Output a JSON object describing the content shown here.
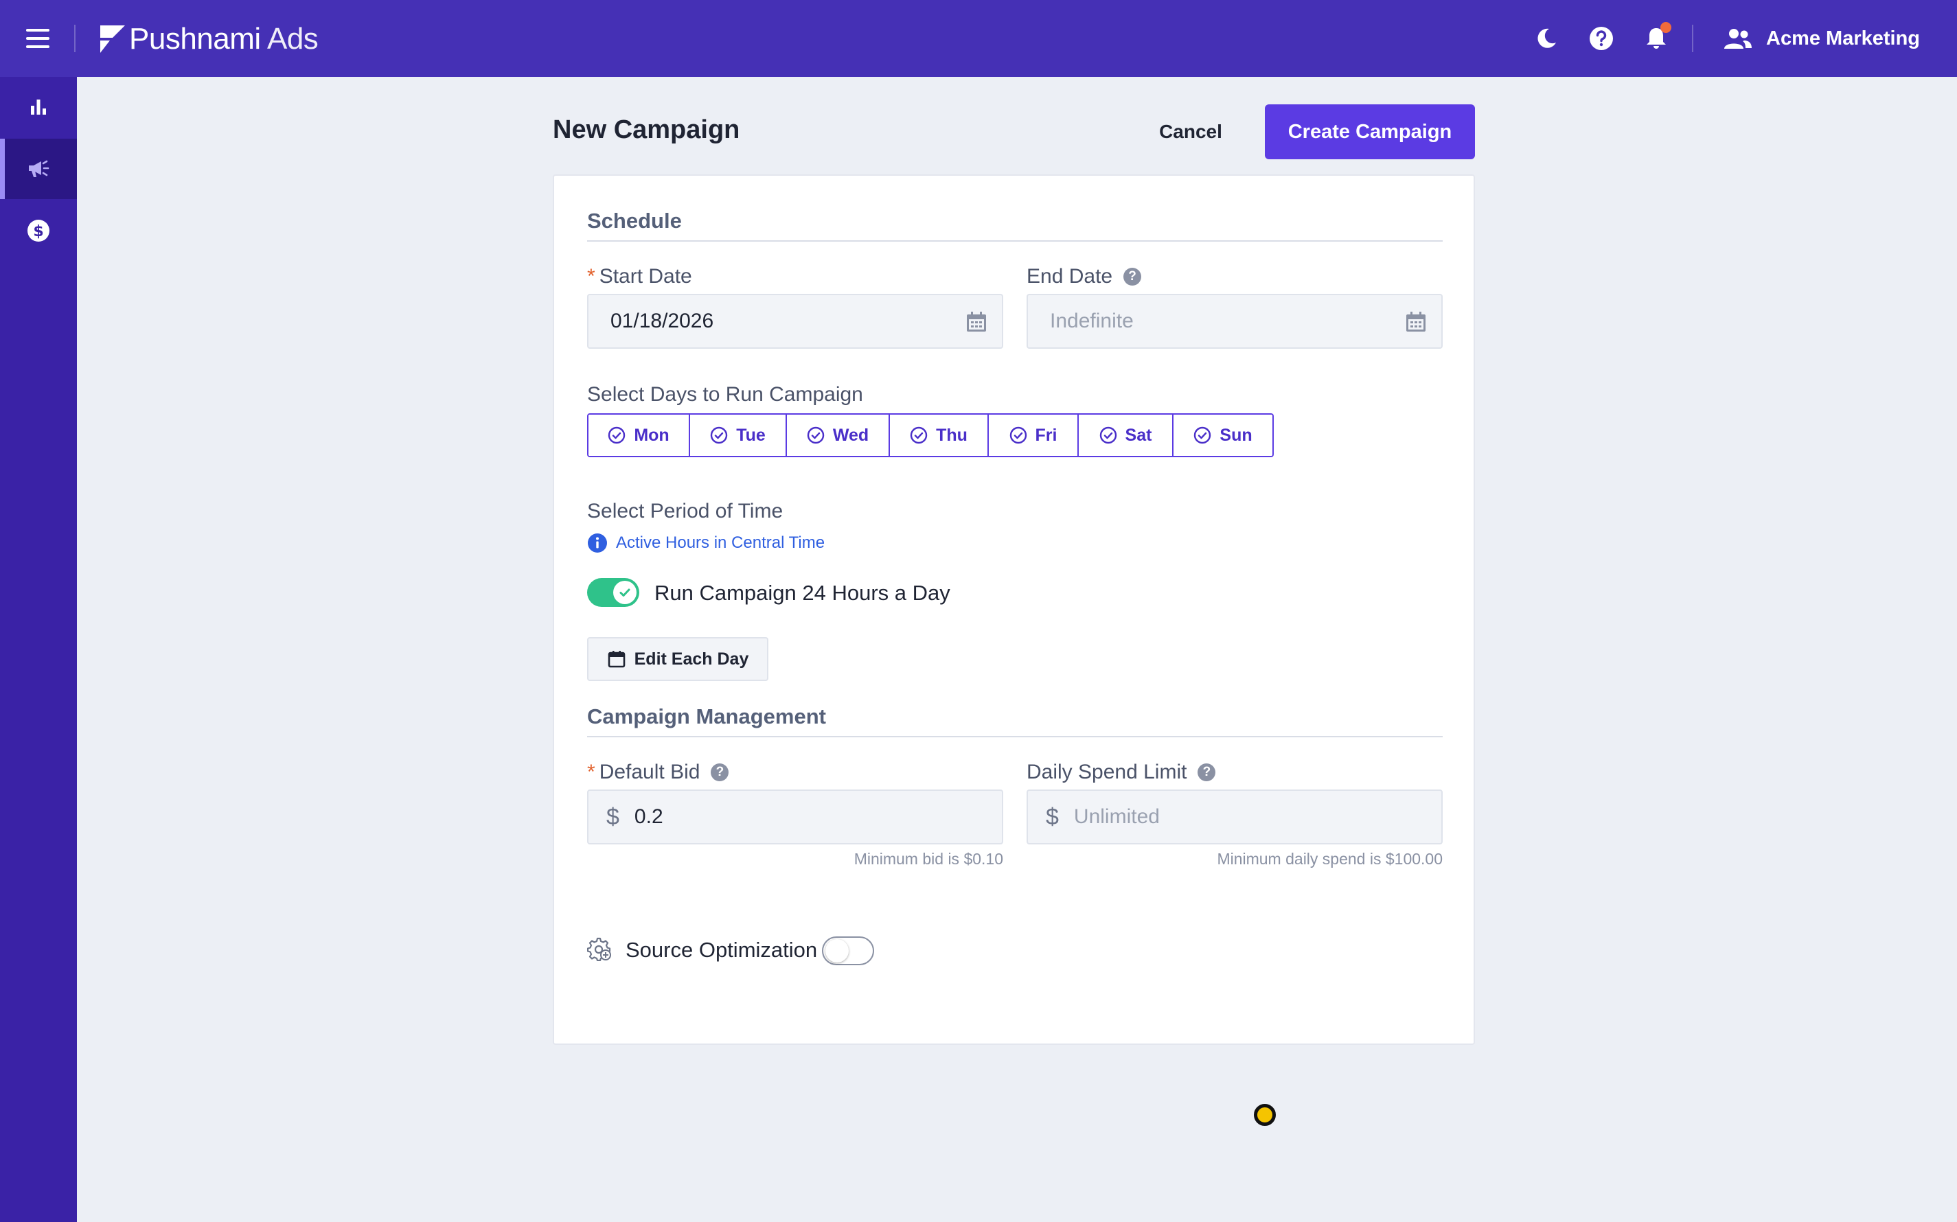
{
  "app": {
    "brand_main": "Pushnami",
    "brand_sub": " Ads",
    "account_name": "Acme Marketing"
  },
  "topbar_icons": [
    "menu-icon",
    "moon-icon",
    "help-icon",
    "bell-icon",
    "users-icon"
  ],
  "sidebar": {
    "items": [
      {
        "name": "analytics",
        "icon": "bar-chart-icon",
        "active": false
      },
      {
        "name": "campaigns",
        "icon": "megaphone-icon",
        "active": true
      },
      {
        "name": "billing",
        "icon": "dollar-circle-icon",
        "active": false
      }
    ]
  },
  "header": {
    "title": "New Campaign",
    "cancel_label": "Cancel",
    "create_label": "Create Campaign"
  },
  "schedule": {
    "section_title": "Schedule",
    "start_date_label": "Start Date",
    "start_date_value": "01/18/2026",
    "end_date_label": "End Date",
    "end_date_placeholder": "Indefinite",
    "days_label": "Select Days to Run Campaign",
    "days": [
      "Mon",
      "Tue",
      "Wed",
      "Thu",
      "Fri",
      "Sat",
      "Sun"
    ],
    "period_label": "Select Period of Time",
    "timezone_note": "Active Hours in Central Time",
    "run_24h_label": "Run Campaign 24 Hours a Day",
    "run_24h_on": true,
    "edit_each_day_label": "Edit Each Day"
  },
  "management": {
    "section_title": "Campaign Management",
    "default_bid_label": "Default Bid",
    "default_bid_value": "0.2",
    "default_bid_hint": "Minimum bid is $0.10",
    "daily_limit_label": "Daily Spend Limit",
    "daily_limit_placeholder": "Unlimited",
    "daily_limit_hint": "Minimum daily spend is $100.00",
    "currency_symbol": "$",
    "source_opt_label": "Source Optimization",
    "source_opt_on": false
  },
  "colors": {
    "topbar": "#4530b5",
    "sidebar": "#3a22a6",
    "accent": "#5b3be3",
    "toggle_on": "#2fc28a",
    "required": "#e2622e",
    "notification": "#f26b3a"
  }
}
